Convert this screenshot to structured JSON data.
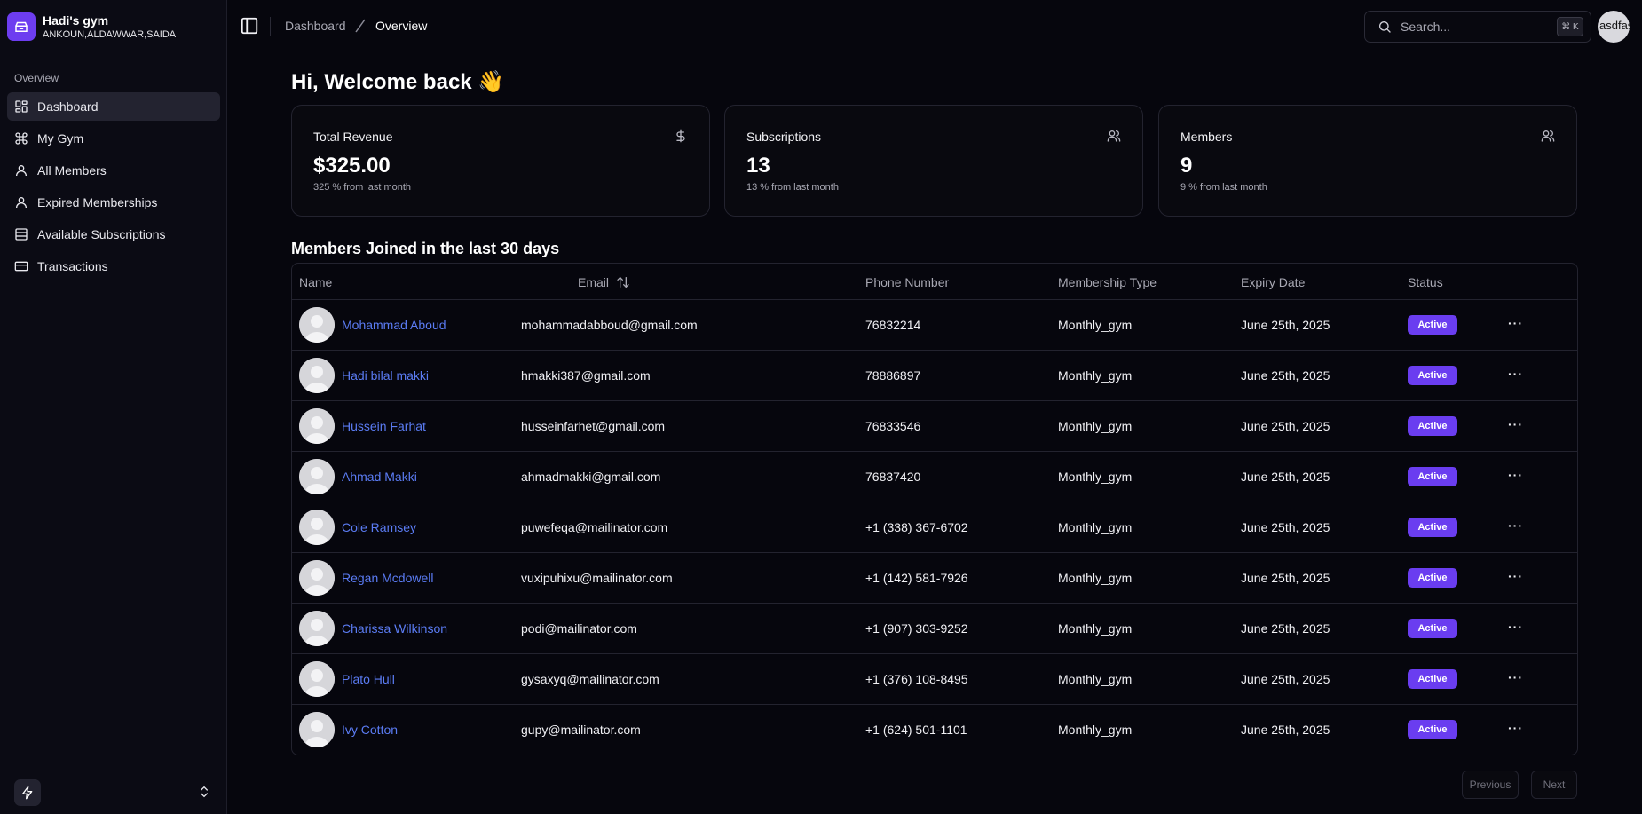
{
  "brand": {
    "name": "Hadi's gym",
    "location": "ANKOUN,ALDAWWAR,SAIDA"
  },
  "sidebar": {
    "section_label": "Overview",
    "items": [
      {
        "label": "Dashboard",
        "icon": "dashboard-icon",
        "active": true
      },
      {
        "label": "My Gym",
        "icon": "command-icon"
      },
      {
        "label": "All Members",
        "icon": "user-icon"
      },
      {
        "label": "Expired Memberships",
        "icon": "user-icon"
      },
      {
        "label": "Available Subscriptions",
        "icon": "archive-icon"
      },
      {
        "label": "Transactions",
        "icon": "credit-card-icon"
      }
    ]
  },
  "header": {
    "breadcrumb": [
      "Dashboard",
      "Overview"
    ],
    "search_placeholder": "Search...",
    "search_shortcut": "⌘ K",
    "user_text": "asdfas"
  },
  "main": {
    "welcome": "Hi, Welcome back 👋",
    "cards": [
      {
        "title": "Total Revenue",
        "value": "$325.00",
        "sub": "325 % from last month",
        "icon": "dollar-icon"
      },
      {
        "title": "Subscriptions",
        "value": "13",
        "sub": "13 % from last month",
        "icon": "users-icon"
      },
      {
        "title": "Members",
        "value": "9",
        "sub": "9 % from last month",
        "icon": "users-icon"
      }
    ],
    "table_title": "Members Joined in the last 30 days",
    "columns": [
      "Name",
      "Email",
      "Phone Number",
      "Membership Type",
      "Expiry Date",
      "Status"
    ],
    "rows": [
      {
        "name": "Mohammad Aboud",
        "email": "mohammadabboud@gmail.com",
        "phone": "76832214",
        "type": "Monthly_gym",
        "expiry": "June 25th, 2025",
        "status": "Active"
      },
      {
        "name": "Hadi bilal makki",
        "email": "hmakki387@gmail.com",
        "phone": "78886897",
        "type": "Monthly_gym",
        "expiry": "June 25th, 2025",
        "status": "Active"
      },
      {
        "name": "Hussein Farhat",
        "email": "husseinfarhet@gmail.com",
        "phone": "76833546",
        "type": "Monthly_gym",
        "expiry": "June 25th, 2025",
        "status": "Active"
      },
      {
        "name": "Ahmad Makki",
        "email": "ahmadmakki@gmail.com",
        "phone": "76837420",
        "type": "Monthly_gym",
        "expiry": "June 25th, 2025",
        "status": "Active"
      },
      {
        "name": "Cole Ramsey",
        "email": "puwefeqa@mailinator.com",
        "phone": "+1 (338) 367-6702",
        "type": "Monthly_gym",
        "expiry": "June 25th, 2025",
        "status": "Active"
      },
      {
        "name": "Regan Mcdowell",
        "email": "vuxipuhixu@mailinator.com",
        "phone": "+1 (142) 581-7926",
        "type": "Monthly_gym",
        "expiry": "June 25th, 2025",
        "status": "Active"
      },
      {
        "name": "Charissa Wilkinson",
        "email": "podi@mailinator.com",
        "phone": "+1 (907) 303-9252",
        "type": "Monthly_gym",
        "expiry": "June 25th, 2025",
        "status": "Active"
      },
      {
        "name": "Plato Hull",
        "email": "gysaxyq@mailinator.com",
        "phone": "+1 (376) 108-8495",
        "type": "Monthly_gym",
        "expiry": "June 25th, 2025",
        "status": "Active"
      },
      {
        "name": "Ivy Cotton",
        "email": "gupy@mailinator.com",
        "phone": "+1 (624) 501-1101",
        "type": "Monthly_gym",
        "expiry": "June 25th, 2025",
        "status": "Active"
      }
    ],
    "row_actions": "···",
    "pagination": {
      "previous": "Previous",
      "next": "Next"
    }
  },
  "colors": {
    "accent": "#6a3df0",
    "link": "#5b7cf4",
    "background": "#06060d",
    "sidebar": "#0b0b14"
  }
}
